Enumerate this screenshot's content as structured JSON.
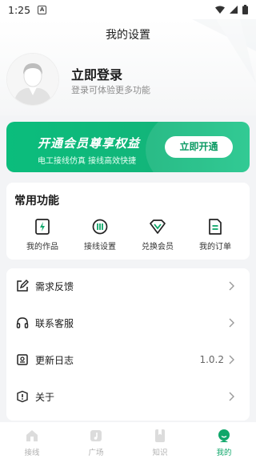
{
  "status_bar": {
    "time": "1:25",
    "notification_letter": "A"
  },
  "header": {
    "title": "我的设置"
  },
  "profile": {
    "login_title": "立即登录",
    "login_subtitle": "登录可体验更多功能"
  },
  "vip_banner": {
    "title": "开通会员尊享权益",
    "subtitle": "电工接线仿真   接线高效快捷",
    "button_label": "立即开通",
    "accent": "#12b57a"
  },
  "functions": {
    "title": "常用功能",
    "items": [
      {
        "label": "我的作品",
        "icon": "lightning-doc-icon"
      },
      {
        "label": "接线设置",
        "icon": "circuit-icon"
      },
      {
        "label": "兑换会员",
        "icon": "diamond-icon"
      },
      {
        "label": "我的订单",
        "icon": "order-list-icon"
      }
    ]
  },
  "menu": {
    "items": [
      {
        "label": "需求反馈",
        "icon": "edit-icon",
        "value": ""
      },
      {
        "label": "联系客服",
        "icon": "headset-icon",
        "value": ""
      },
      {
        "label": "更新日志",
        "icon": "log-icon",
        "value": "1.0.2"
      },
      {
        "label": "关于",
        "icon": "info-icon",
        "value": ""
      }
    ]
  },
  "tabbar": {
    "items": [
      {
        "label": "接线",
        "icon": "home-icon",
        "active": false
      },
      {
        "label": "广场",
        "icon": "music-note-icon",
        "active": false
      },
      {
        "label": "知识",
        "icon": "bookmark-icon",
        "active": false
      },
      {
        "label": "我的",
        "icon": "profile-icon",
        "active": true
      }
    ],
    "active_color": "#0fa76a"
  }
}
